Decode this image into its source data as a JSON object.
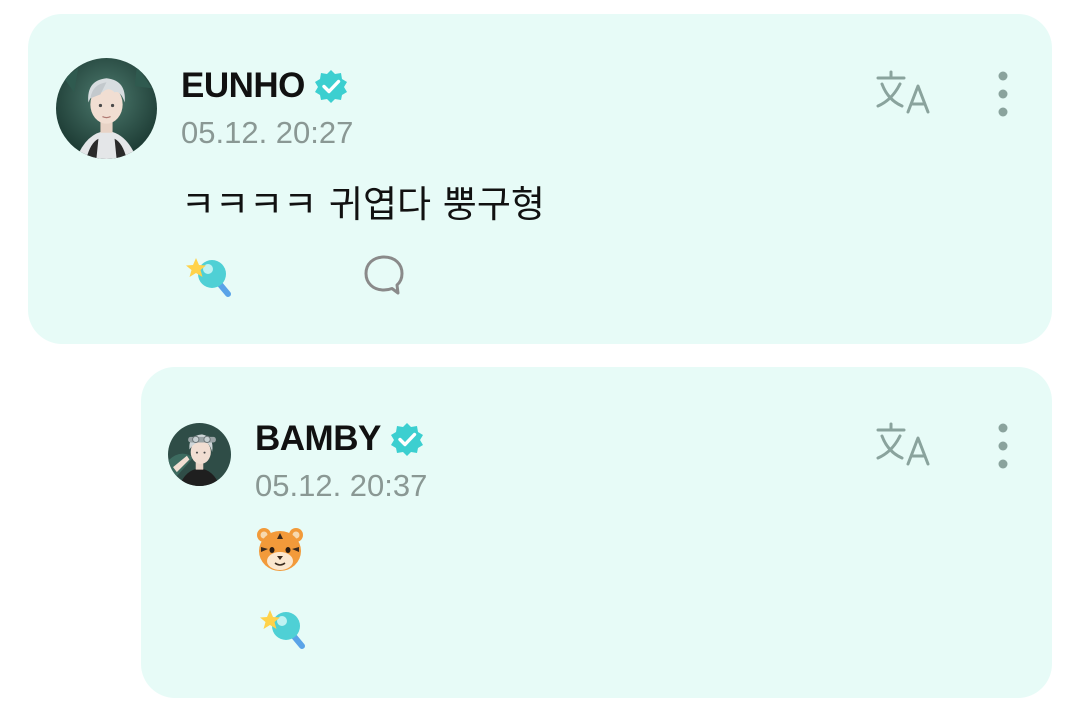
{
  "post": {
    "author": "EUNHO",
    "timestamp": "05.12. 20:27",
    "text": "ㅋㅋㅋㅋ 귀엽다 뿡구형",
    "avatar": "eunho-avatar-illustration",
    "verified": true,
    "icons": [
      "verified-badge-icon",
      "translate-icon",
      "more-vertical-icon",
      "reaction-icon",
      "comment-icon"
    ]
  },
  "reply": {
    "author": "BAMBY",
    "timestamp": "05.12. 20:37",
    "emoji": "tiger-face",
    "avatar": "bamby-avatar-illustration",
    "verified": true,
    "icons": [
      "verified-badge-icon",
      "translate-icon",
      "more-vertical-icon",
      "reaction-icon"
    ]
  },
  "colors": {
    "card_bg": "#e7fbf7",
    "accent": "#3ccfd0",
    "icon_gray": "#8aa39d",
    "text": "#111111",
    "muted": "#8a9894"
  }
}
